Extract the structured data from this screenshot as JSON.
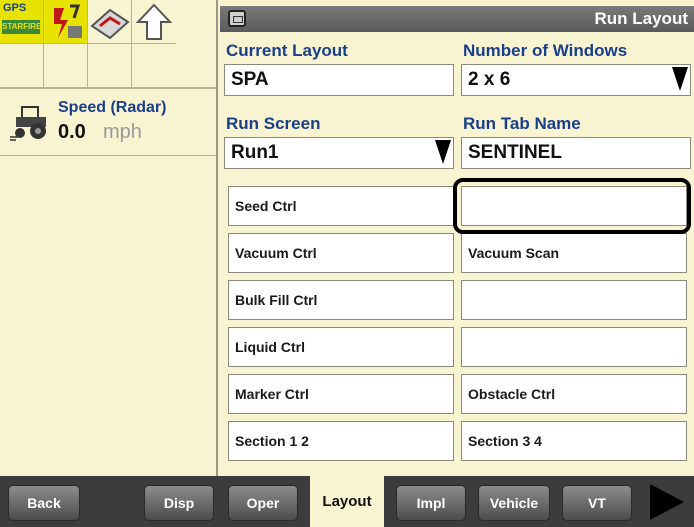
{
  "status_icons": {
    "gps_label": "GPS",
    "gps_bar_label": "STARFIRE",
    "icons": [
      "gps-receiver-icon",
      "guidance-icon",
      "section-control-icon",
      "up-arrow-icon"
    ]
  },
  "speed": {
    "label": "Speed (Radar)",
    "value": "0.0",
    "unit": "mph",
    "icon": "tractor-icon"
  },
  "header": {
    "title": "Run Layout",
    "icon": "screen-icon"
  },
  "current_layout": {
    "label": "Current Layout",
    "value": "SPA"
  },
  "number_of_windows": {
    "label": "Number of Windows",
    "value": "2 x 6"
  },
  "run_screen": {
    "label": "Run Screen",
    "value": "Run1"
  },
  "run_tab_name": {
    "label": "Run Tab Name",
    "value": "SENTINEL"
  },
  "windows": [
    {
      "left": "Seed Ctrl",
      "right": ""
    },
    {
      "left": "Vacuum Ctrl",
      "right": "Vacuum Scan"
    },
    {
      "left": "Bulk Fill Ctrl",
      "right": ""
    },
    {
      "left": "Liquid Ctrl",
      "right": ""
    },
    {
      "left": "Marker Ctrl",
      "right": "Obstacle Ctrl"
    },
    {
      "left": "Section 1 2",
      "right": "Section 3 4"
    }
  ],
  "tabs": {
    "back": "Back",
    "disp": "Disp",
    "oper": "Oper",
    "layout": "Layout",
    "impl": "Impl",
    "vehicle": "Vehicle",
    "vt": "VT",
    "active": "Layout"
  },
  "colors": {
    "background": "#f8f4d2",
    "label_blue": "#1a3f8a",
    "status_yellow": "#e8e200",
    "header_gray": "#6a6a6a"
  }
}
